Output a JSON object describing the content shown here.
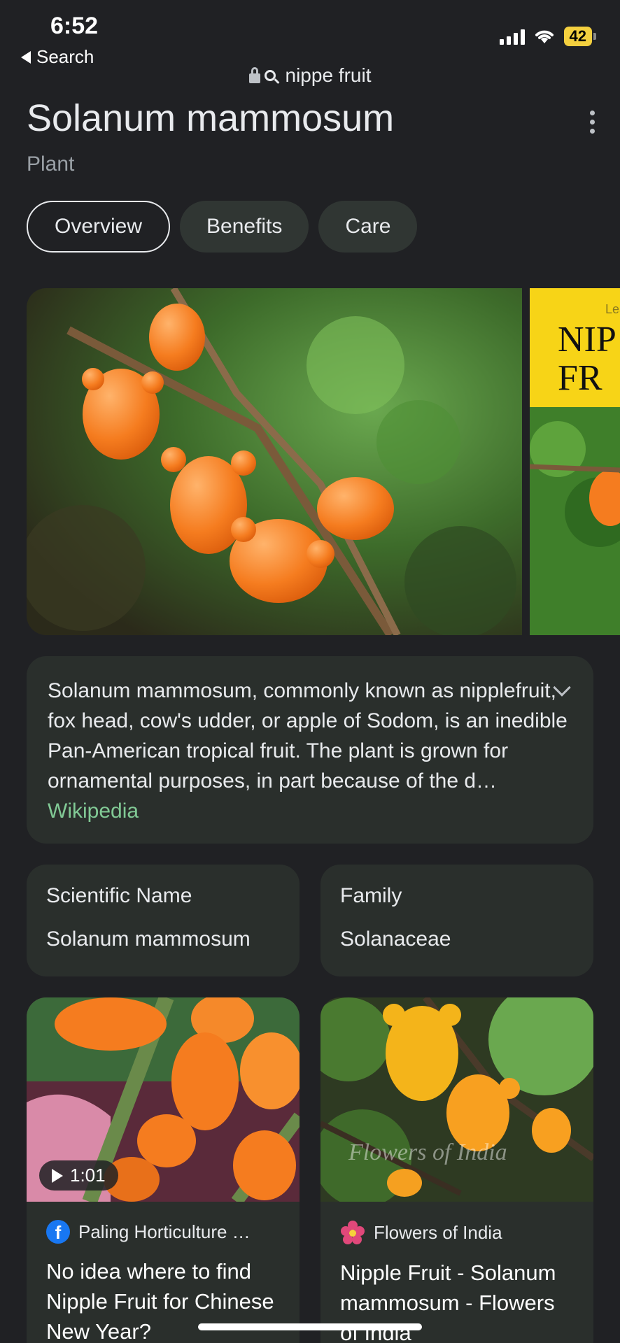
{
  "status": {
    "time": "6:52",
    "back_label": "Search",
    "battery": "42"
  },
  "url": {
    "query": "nippe fruit"
  },
  "header": {
    "title": "Solanum mammosum",
    "subtitle": "Plant"
  },
  "tabs": [
    {
      "label": "Overview",
      "active": true
    },
    {
      "label": "Benefits",
      "active": false
    },
    {
      "label": "Care",
      "active": false
    }
  ],
  "hero_image_2": {
    "banner_lines": [
      "Lea",
      "NIP",
      "FR"
    ]
  },
  "description": {
    "text": "Solanum mammosum, commonly known as nipplefruit, fox head, cow's udder, or apple of Sodom, is an inedible Pan-American tropical fruit. The plant is grown for ornamental purposes, in part because of the d…",
    "source": "Wikipedia"
  },
  "facts": [
    {
      "label": "Scientific Name",
      "value": "Solanum mammosum"
    },
    {
      "label": "Family",
      "value": "Solanaceae"
    }
  ],
  "cards": [
    {
      "source": "Paling Horticulture …",
      "duration": "1:01",
      "headline": "No idea where to find Nipple Fruit for Chinese New Year?",
      "icon": "facebook-icon"
    },
    {
      "source": "Flowers of India",
      "headline": "Nipple Fruit - Solanum mammosum - Flowers of India",
      "watermark": "Flowers of India",
      "icon": "flower-icon"
    }
  ],
  "colors": {
    "background": "#202124",
    "card": "#2a2f2c",
    "link": "#81c995",
    "fruit": "#f57c1f"
  }
}
